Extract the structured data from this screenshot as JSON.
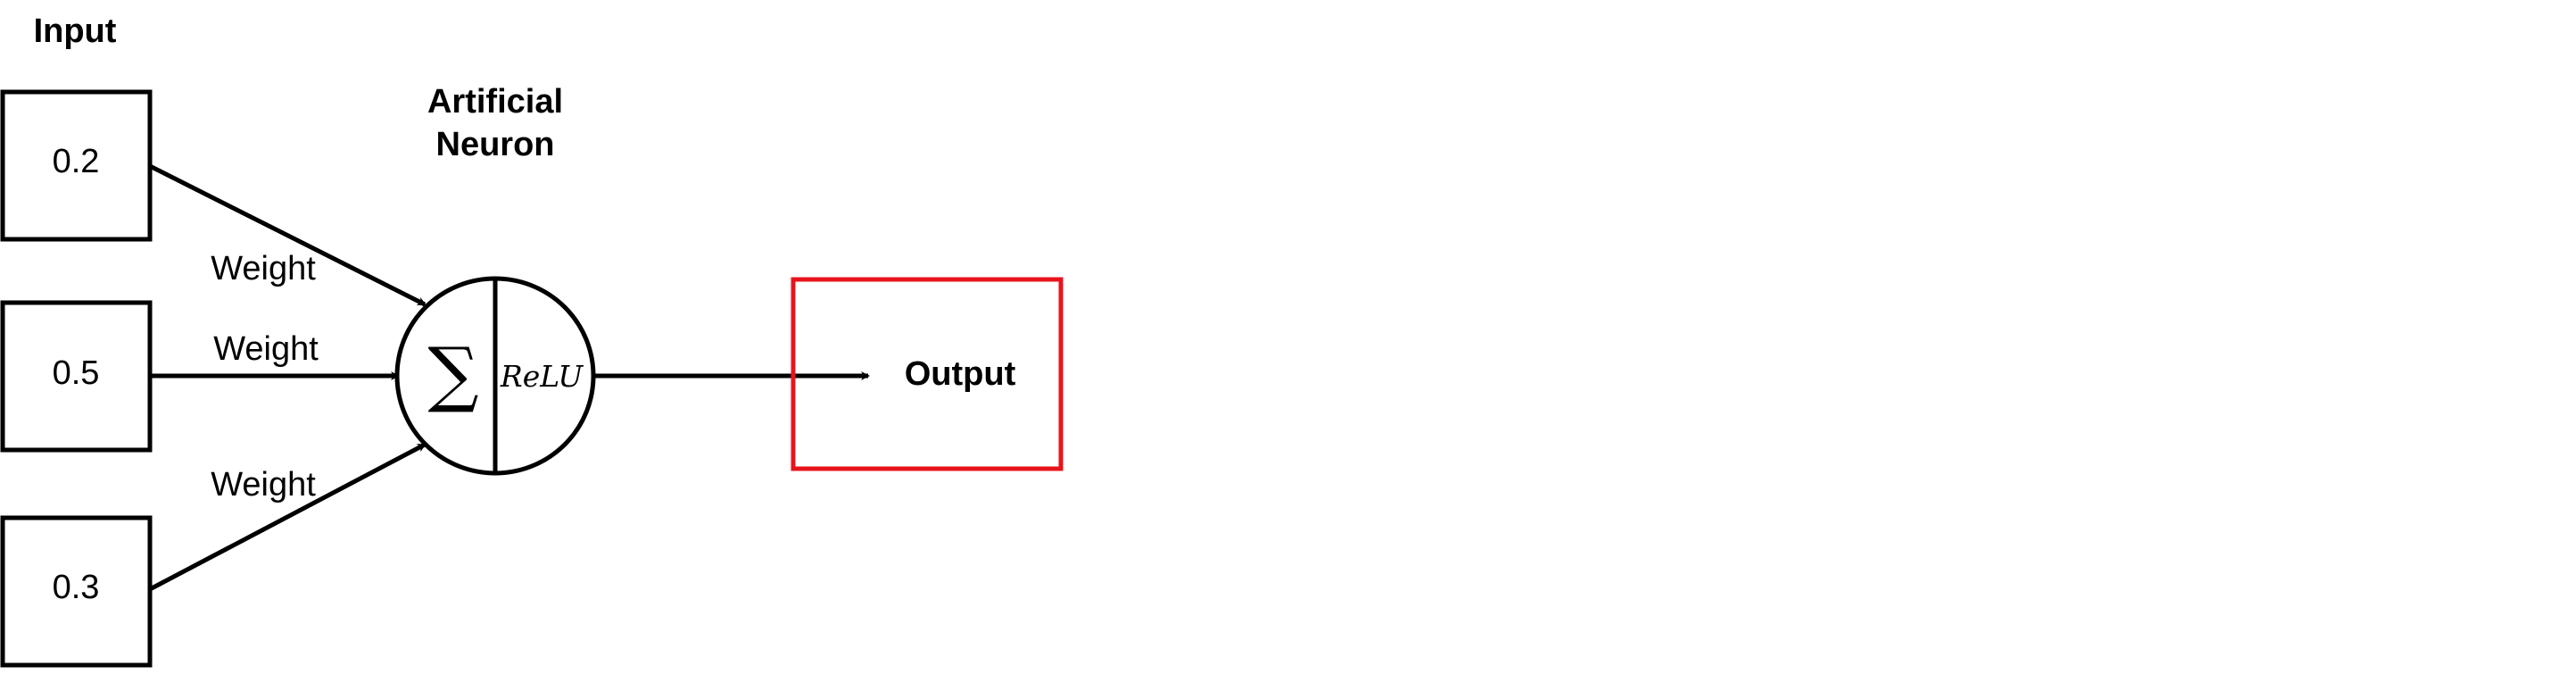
{
  "labels": {
    "input_heading": "Input",
    "neuron_heading_line1": "Artificial",
    "neuron_heading_line2": "Neuron",
    "output": "Output"
  },
  "inputs": [
    {
      "value": "0.2",
      "weight_label": "Weight"
    },
    {
      "value": "0.5",
      "weight_label": "Weight"
    },
    {
      "value": "0.3",
      "weight_label": "Weight"
    }
  ],
  "neuron": {
    "sum_symbol": "∑",
    "activation": "ReLU"
  },
  "colors": {
    "stroke": "#000000",
    "output_box": "#e8141c"
  }
}
